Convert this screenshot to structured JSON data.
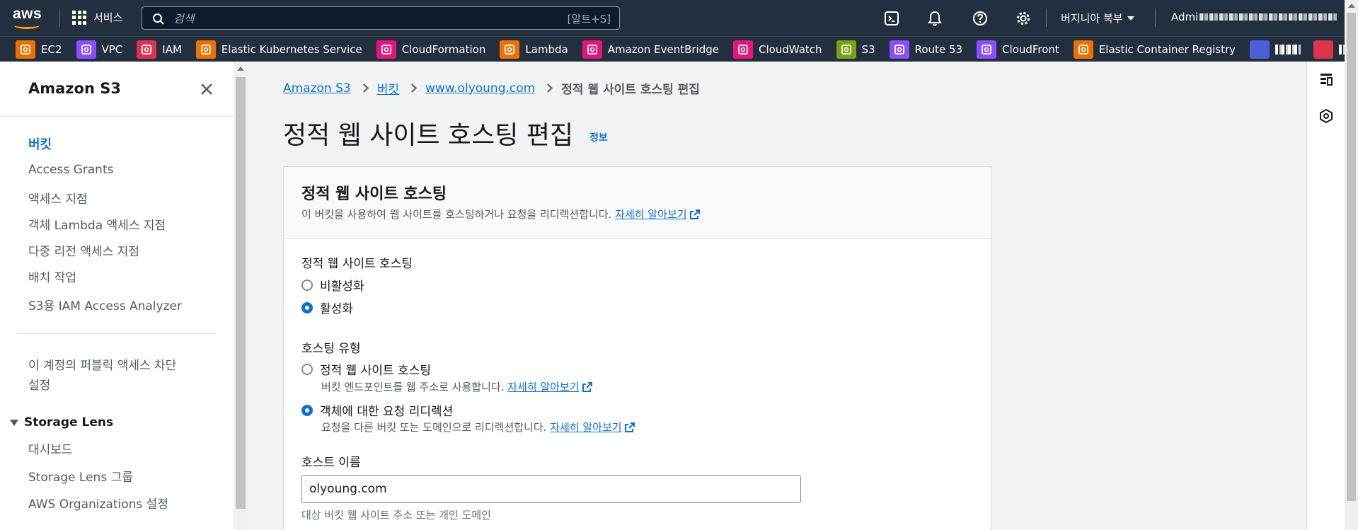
{
  "topbar": {
    "logo_text": "aws",
    "services_label": "서비스",
    "search_placeholder": "검색",
    "search_shortcut": "[알트+S]",
    "region": "버지니아 북부",
    "account_prefix": "Admi"
  },
  "favorites": [
    {
      "label": "EC2",
      "color": "#ed7100"
    },
    {
      "label": "VPC",
      "color": "#8c4fff"
    },
    {
      "label": "IAM",
      "color": "#dd344c"
    },
    {
      "label": "Elastic Kubernetes Service",
      "color": "#ed7100"
    },
    {
      "label": "CloudFormation",
      "color": "#e7157b"
    },
    {
      "label": "Lambda",
      "color": "#ed7100"
    },
    {
      "label": "Amazon EventBridge",
      "color": "#e7157b"
    },
    {
      "label": "CloudWatch",
      "color": "#e7157b"
    },
    {
      "label": "S3",
      "color": "#7aa116"
    },
    {
      "label": "Route 53",
      "color": "#8c4fff"
    },
    {
      "label": "CloudFront",
      "color": "#8c4fff"
    },
    {
      "label": "Elastic Container Registry",
      "color": "#ed7100"
    }
  ],
  "sidebar": {
    "title": "Amazon S3",
    "items": [
      {
        "label": "버킷"
      },
      {
        "label": "Access Grants"
      },
      {
        "label": "액세스 지점"
      },
      {
        "label": "객체 Lambda 액세스 지점"
      },
      {
        "label": "다중 리전 액세스 지점"
      },
      {
        "label": "배치 작업"
      },
      {
        "label": "S3용 IAM Access Analyzer"
      },
      {
        "label": "이 계정의 퍼블릭 액세스 차단"
      },
      {
        "label": "설정"
      }
    ],
    "storage_lens": {
      "label": "Storage Lens",
      "items": [
        {
          "label": "대시보드"
        },
        {
          "label": "Storage Lens 그룹"
        },
        {
          "label": "AWS Organizations 설정"
        }
      ]
    }
  },
  "breadcrumb": {
    "items": [
      "Amazon S3",
      "버킷",
      "www.olyoung.com"
    ],
    "current": "정적 웹 사이트 호스팅 편집"
  },
  "page": {
    "title": "정적 웹 사이트 호스팅 편집",
    "info_label": "정보"
  },
  "panel": {
    "title": "정적 웹 사이트 호스팅",
    "description": "이 버킷을 사용하여 웹 사이트를 호스팅하거나 요청을 리디렉션합니다.",
    "learn_more": "자세히 알아보기",
    "hosting_label": "정적 웹 사이트 호스팅",
    "hosting_options": {
      "disable": "비활성화",
      "enable": "활성화"
    },
    "hosting_type_label": "호스팅 유형",
    "type_static": "정적 웹 사이트 호스팅",
    "type_static_desc": "버킷 엔드포인트를 웹 주소로 사용합니다.",
    "type_redirect": "객체에 대한 요청 리디렉션",
    "type_redirect_desc": "요청을 다른 버킷 또는 도메인으로 리디렉션합니다.",
    "host_name_label": "호스트 이름",
    "host_name_value": "olyoung.com",
    "host_name_hint": "대상 버킷 웹 사이트 주소 또는 개인 도메인"
  }
}
